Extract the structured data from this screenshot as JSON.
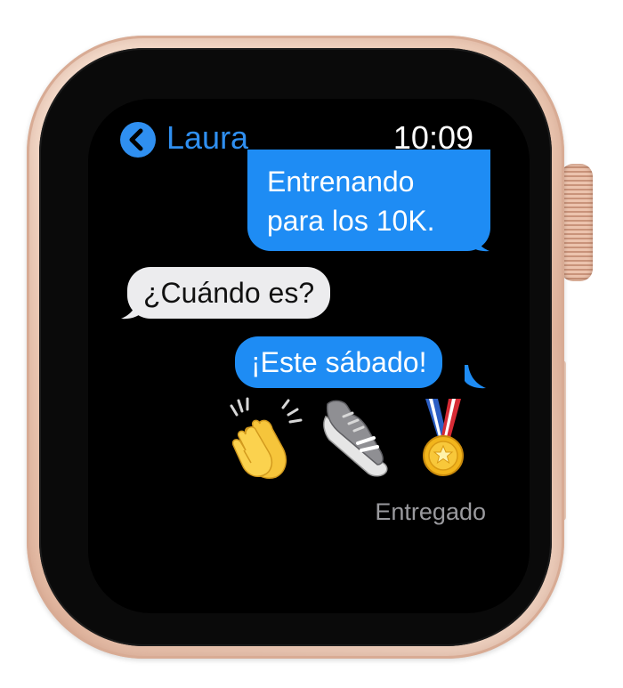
{
  "header": {
    "back_icon": "chevron-left-icon",
    "contact_name": "Laura",
    "time": "10:09"
  },
  "messages": [
    {
      "direction": "sent",
      "lines": [
        "Entrenando",
        "para los 10K."
      ]
    },
    {
      "direction": "received",
      "text": "¿Cuándo es?"
    },
    {
      "direction": "sent",
      "text": "¡Este sábado!"
    }
  ],
  "emoji_reply": [
    "clapping-hands-emoji",
    "running-shoe-emoji",
    "sports-medal-emoji"
  ],
  "status": "Entregado",
  "colors": {
    "accent": "#2f8ff0",
    "sent_bubble": "#1e8cf4",
    "received_bubble": "#ececee",
    "screen": "#000000",
    "case": "#ecc9b4",
    "status_text": "#9a9a9e"
  }
}
